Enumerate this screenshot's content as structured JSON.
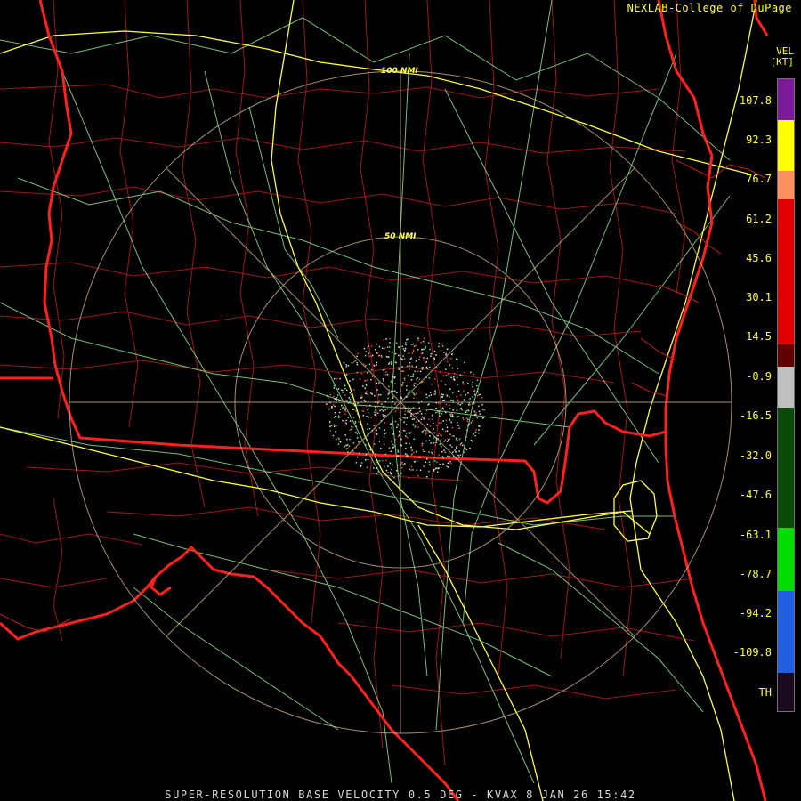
{
  "credit": "NEXLAB-College of DuPage",
  "footer": "SUPER-RESOLUTION BASE VELOCITY 0.5 DEG - KVAX 8 JAN 26 15:42",
  "range_rings": [
    {
      "label": "50 NMI"
    },
    {
      "label": "100 NMI"
    }
  ],
  "legend": {
    "title_line1": "VEL",
    "title_line2": "[KT]",
    "labels": [
      "107.8",
      "92.3",
      "76.7",
      "61.2",
      "45.6",
      "30.1",
      "14.5",
      "-0.9",
      "-16.5",
      "-32.0",
      "-47.6",
      "-63.1",
      "-78.7",
      "-94.2",
      "-109.8",
      "TH"
    ],
    "bands": [
      {
        "color": "#7a1a9a",
        "from": 0.0,
        "to": 0.065
      },
      {
        "color": "#ffff00",
        "from": 0.065,
        "to": 0.145
      },
      {
        "color": "#ff9060",
        "from": 0.145,
        "to": 0.19
      },
      {
        "color": "#e00000",
        "from": 0.19,
        "to": 0.42
      },
      {
        "color": "#600000",
        "from": 0.42,
        "to": 0.455
      },
      {
        "color": "#c0c0c0",
        "from": 0.455,
        "to": 0.52
      },
      {
        "color": "#0a4a0a",
        "from": 0.52,
        "to": 0.71
      },
      {
        "color": "#00dd00",
        "from": 0.71,
        "to": 0.81
      },
      {
        "color": "#2060e0",
        "from": 0.81,
        "to": 0.94
      },
      {
        "color": "#1a0a20",
        "from": 0.94,
        "to": 1.0
      }
    ]
  },
  "colors": {
    "state_border": "#ff2020",
    "county_border": "#b01818",
    "highway": "#ffff40",
    "road": "#90e090",
    "range_ring": "#d8c090",
    "echo_red": "#ff4040",
    "echo_green": "#80e080",
    "echo_white": "#e0e0e0"
  }
}
